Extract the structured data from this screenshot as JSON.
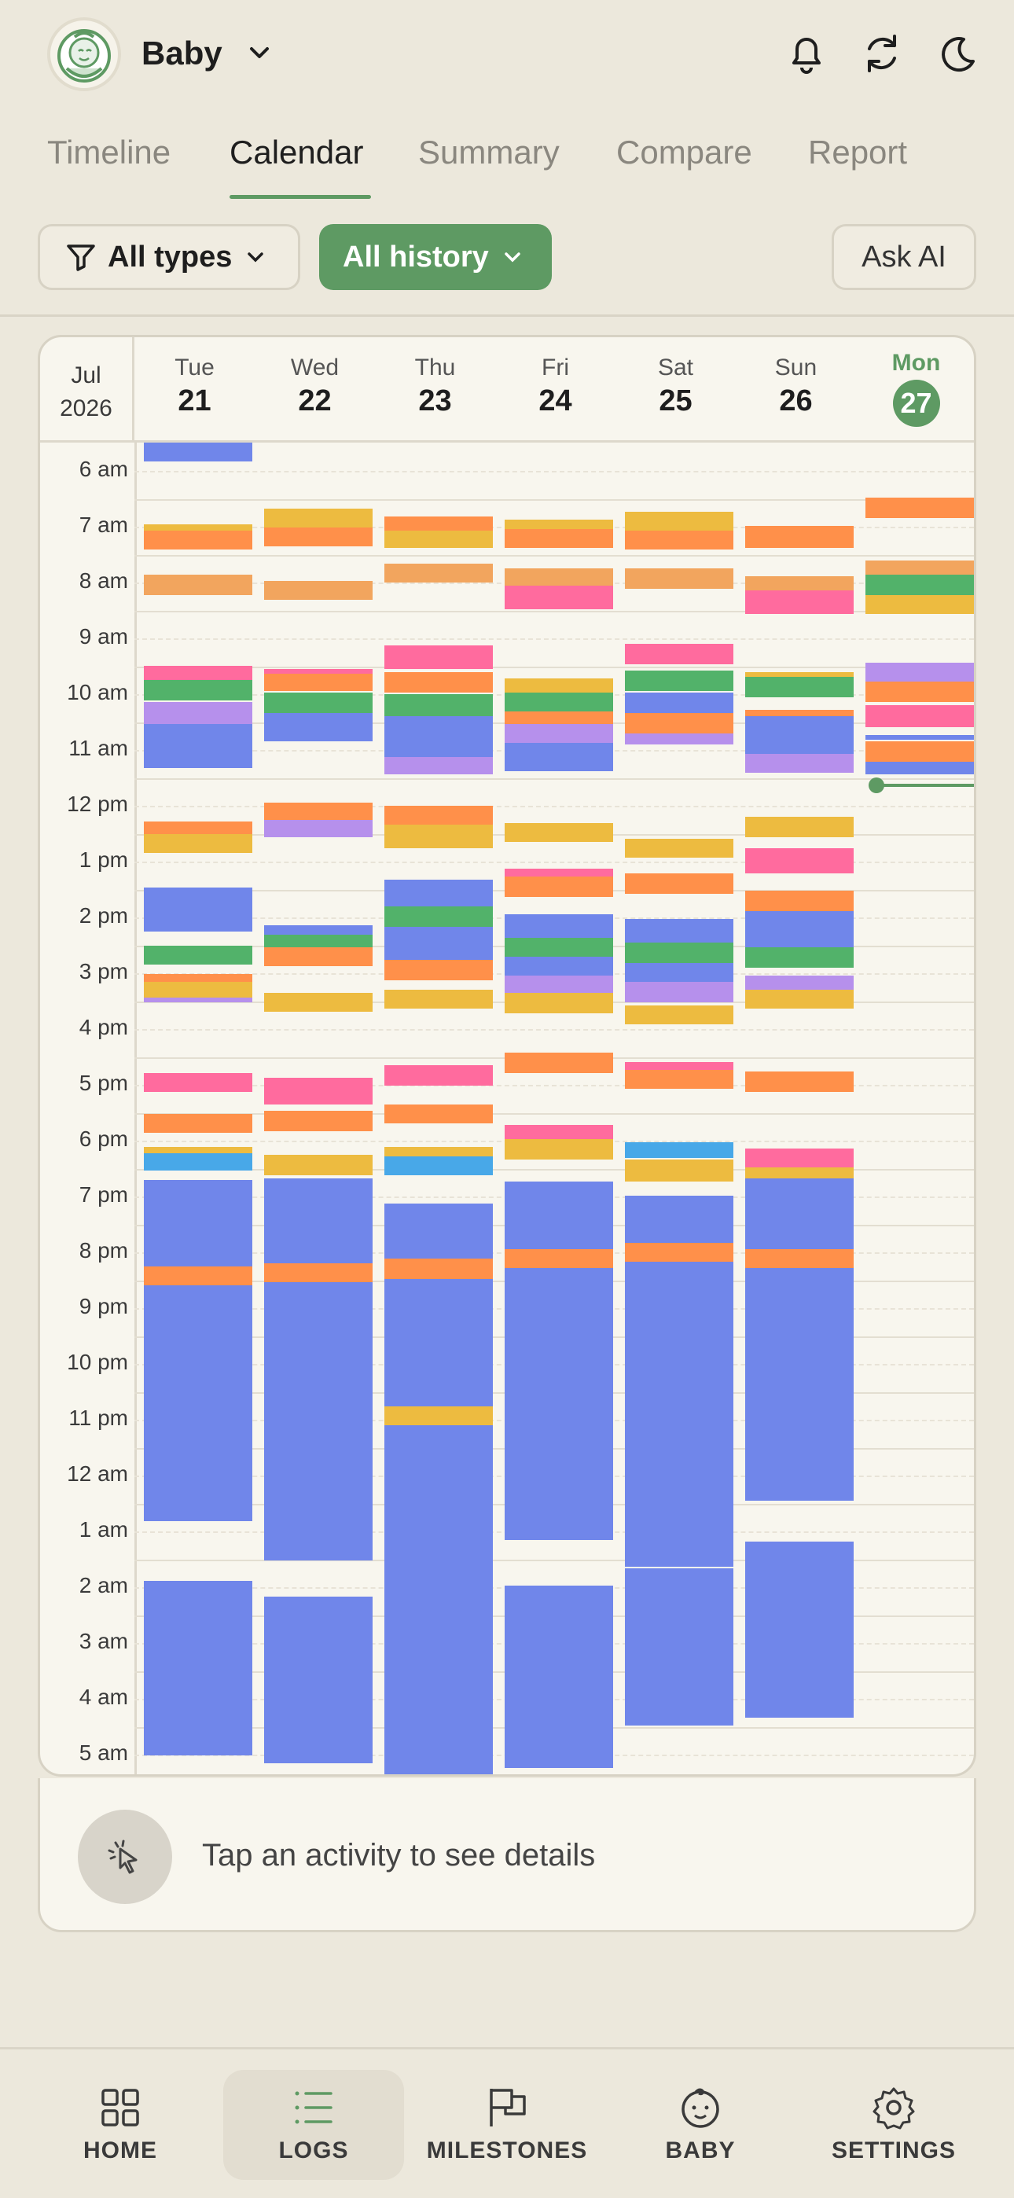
{
  "header": {
    "baby_name": "Baby"
  },
  "tabs": [
    {
      "label": "Timeline",
      "active": false
    },
    {
      "label": "Calendar",
      "active": true
    },
    {
      "label": "Summary",
      "active": false
    },
    {
      "label": "Compare",
      "active": false
    },
    {
      "label": "Report",
      "active": false
    }
  ],
  "filters": {
    "types": "All types",
    "history": "All history",
    "ask_ai": "Ask AI"
  },
  "calendar": {
    "month": "Jul",
    "year": "2026",
    "days": [
      {
        "dow": "Tue",
        "num": "21"
      },
      {
        "dow": "Wed",
        "num": "22"
      },
      {
        "dow": "Thu",
        "num": "23"
      },
      {
        "dow": "Fri",
        "num": "24"
      },
      {
        "dow": "Sat",
        "num": "25"
      },
      {
        "dow": "Sun",
        "num": "26"
      },
      {
        "dow": "Mon",
        "num": "27",
        "today": true
      }
    ],
    "hours": [
      "6 am",
      "7 am",
      "8 am",
      "9 am",
      "10 am",
      "11 am",
      "12 pm",
      "1 pm",
      "2 pm",
      "3 pm",
      "4 pm",
      "5 pm",
      "6 pm",
      "7 pm",
      "8 pm",
      "9 pm",
      "10 pm",
      "11 pm",
      "12 am",
      "1 am",
      "2 am",
      "3 am",
      "4 am",
      "5 am"
    ]
  },
  "detail": {
    "hint": "Tap an activity to see details"
  },
  "nav": [
    {
      "label": "HOME",
      "icon": "grid-icon"
    },
    {
      "label": "LOGS",
      "icon": "list-icon",
      "active": true
    },
    {
      "label": "MILESTONES",
      "icon": "flag-icon"
    },
    {
      "label": "BABY",
      "icon": "baby-face-icon"
    },
    {
      "label": "SETTINGS",
      "icon": "gear-icon"
    }
  ],
  "colors": {
    "accent": "#5E9A63",
    "sleep": "#7086EA",
    "orange": "#FF904A",
    "yellow": "#EDBB40",
    "peach": "#F2A55E",
    "pink": "#FF6B9E",
    "green": "#52B26A",
    "purple": "#B690EC",
    "blue": "#48A8E8"
  }
}
